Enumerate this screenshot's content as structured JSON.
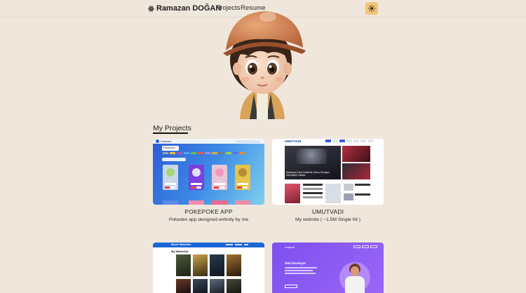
{
  "navbar": {
    "brand": "Ramazan DOĞAN",
    "links": [
      "Projects",
      "Resume"
    ]
  },
  "section": {
    "title": "My Projects"
  },
  "projects": [
    {
      "title": "POKEPOKE APP",
      "desc": "Pokedex app designed entirely by me",
      "thumb_header": "Pokedex",
      "thumb_label": "Pokemons"
    },
    {
      "title": "UMUTVADI",
      "desc": "My website ( ~1.5M Single hit )",
      "thumb_header": "UMUTVADI",
      "thumb_headline": "Sanctuary Zone Incidents: Sumo Grinigins Detroitbine Yasaklı"
    },
    {
      "title": "",
      "desc": "",
      "thumb_header": "Movie Watchlist",
      "thumb_label": "My Watchlist"
    },
    {
      "title": "",
      "desc": "",
      "thumb_header": "rewaport",
      "thumb_label": "Web Developer"
    }
  ],
  "colors": {
    "background": "#f0e7dc",
    "accent": "#f2c67a",
    "card_purple": "#8e5cf5",
    "card_watchlist_header": "#1a66d6"
  }
}
